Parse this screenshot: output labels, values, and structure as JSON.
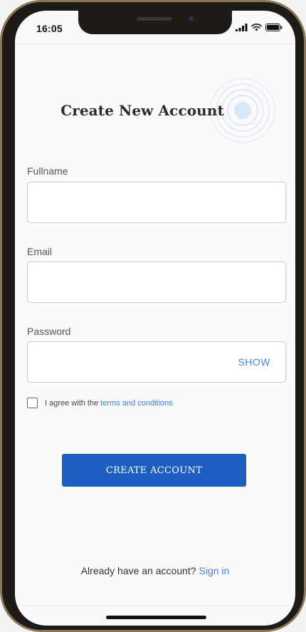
{
  "status_bar": {
    "time": "16:05",
    "icons": [
      "signal-icon",
      "wifi-icon",
      "battery-icon"
    ]
  },
  "page": {
    "title": "Create New Account"
  },
  "form": {
    "fullname": {
      "label": "Fullname",
      "value": "",
      "placeholder": ""
    },
    "email": {
      "label": "Email",
      "value": "",
      "placeholder": ""
    },
    "password": {
      "label": "Password",
      "value": "",
      "placeholder": "",
      "toggle_label": "SHOW"
    },
    "agree": {
      "prefix": "I agree with the",
      "link": "terms and conditions",
      "checked": false
    },
    "submit_label": "CREATE ACCOUNT"
  },
  "footer": {
    "question": "Already have an account?",
    "link": "Sign in"
  },
  "colors": {
    "primary": "#1d5dbf",
    "link": "#3d79d2",
    "background": "#fafafa"
  }
}
